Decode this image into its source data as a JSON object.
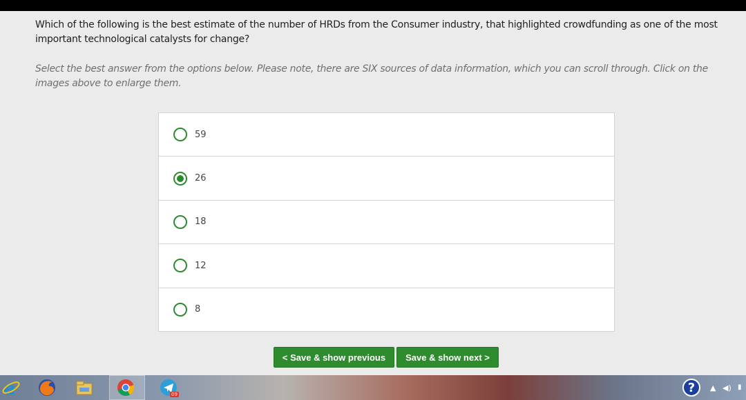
{
  "question": {
    "text": "Which of the following is the best estimate of the number of HRDs from the Consumer industry, that highlighted crowdfunding as one of the most important technological catalysts for change?",
    "instructions": "Select the best answer from the options below. Please note, there are SIX sources of data information, which you can scroll through. Click on the images above to enlarge them."
  },
  "options": [
    {
      "label": "59",
      "selected": false
    },
    {
      "label": "26",
      "selected": true
    },
    {
      "label": "18",
      "selected": false
    },
    {
      "label": "12",
      "selected": false
    },
    {
      "label": "8",
      "selected": false
    }
  ],
  "buttons": {
    "previous": "< Save & show previous",
    "next": "Save & show next >"
  },
  "taskbar": {
    "telegram_badge": "09",
    "apps": [
      "internet-explorer-icon",
      "firefox-icon",
      "file-explorer-icon",
      "chrome-icon",
      "telegram-icon"
    ]
  },
  "colors": {
    "accent": "#2e8b2e",
    "background": "#ebebeb",
    "help": "#1d3f9c"
  }
}
